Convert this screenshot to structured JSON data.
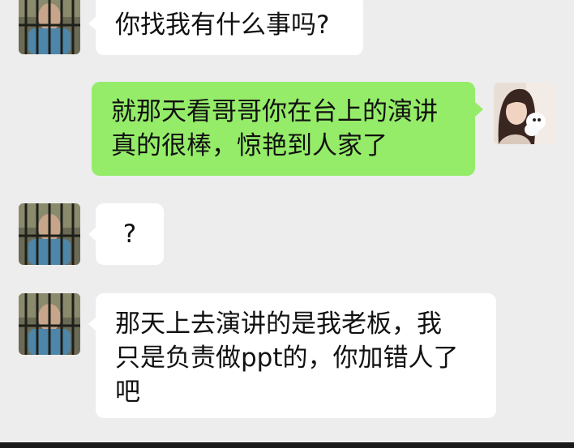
{
  "chat": {
    "messages": [
      {
        "sender": "other",
        "text": "你找我有什么事吗?"
      },
      {
        "sender": "self",
        "text": "就那天看哥哥你在台上的演讲\n真的很棒，惊艳到人家了"
      },
      {
        "sender": "other",
        "text": "?"
      },
      {
        "sender": "other",
        "text": "那天上去演讲的是我老板，我\n只是负责做ppt的，你加错人了\n吧"
      }
    ]
  },
  "colors": {
    "background": "#ededed",
    "incoming_bubble": "#ffffff",
    "outgoing_bubble": "#95ec69"
  }
}
